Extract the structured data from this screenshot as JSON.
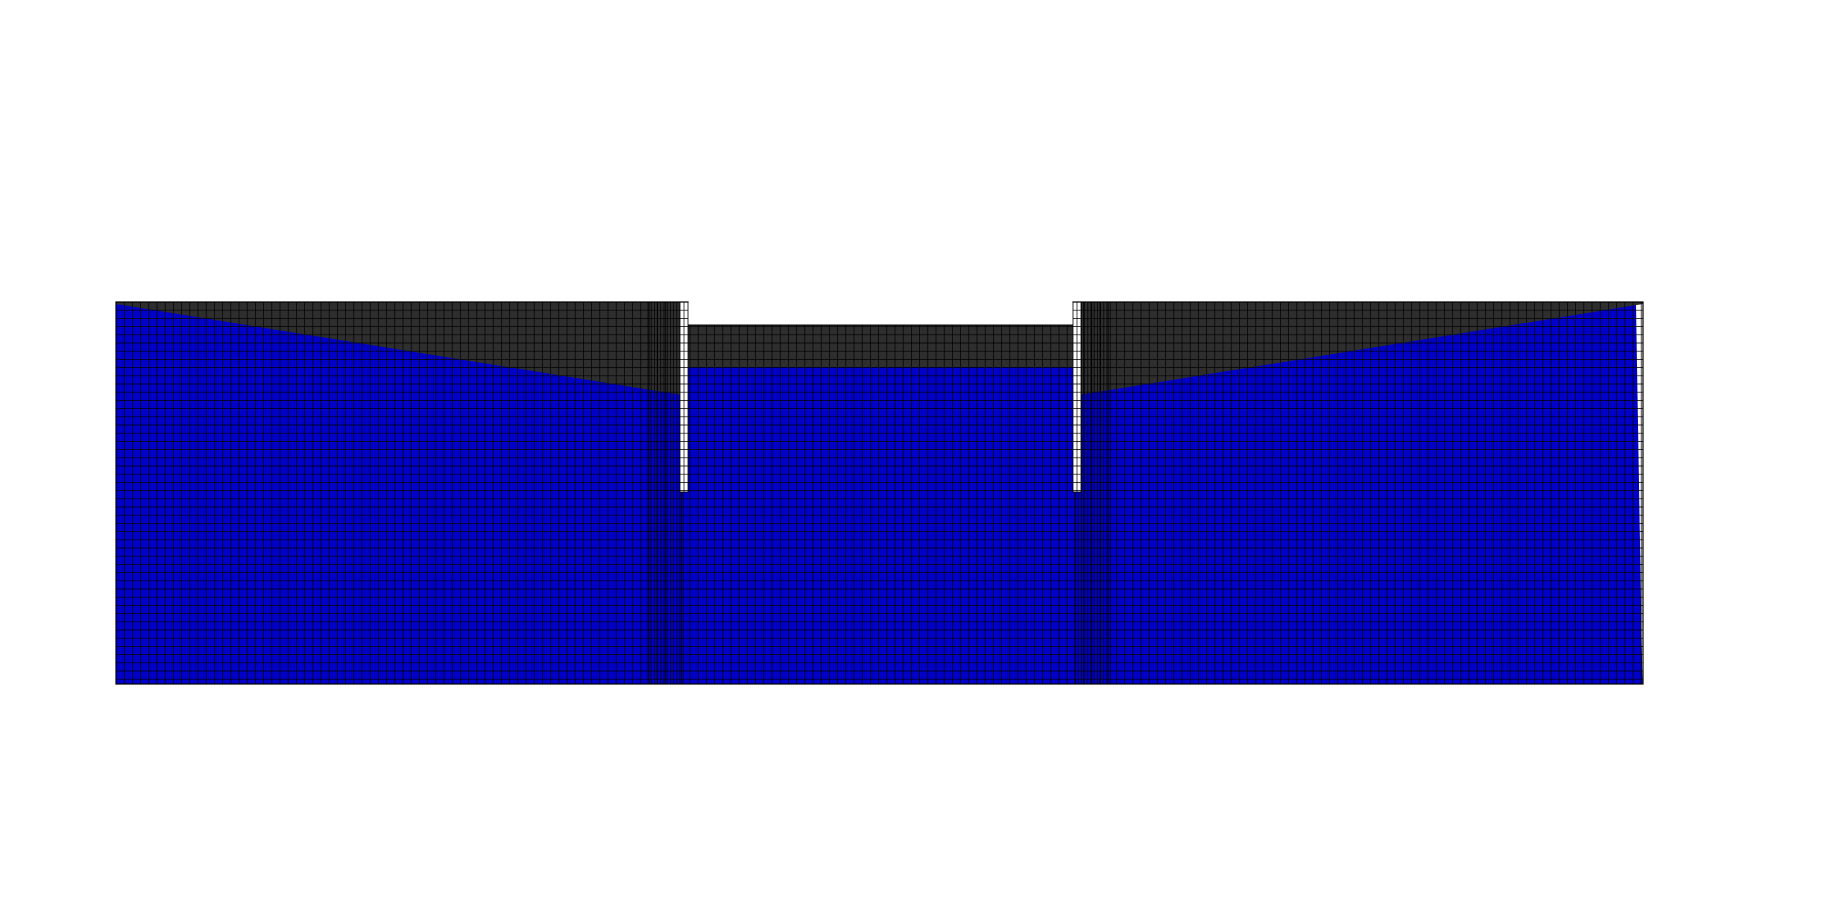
{
  "figure": {
    "type": "finite-element mesh contour plot",
    "description_visible_text": "",
    "palette": {
      "inactive_soil": "#2e2e2e",
      "wall": "#ffffff",
      "mesh_line": "#000000",
      "contour_bands": [
        "#0000c8",
        "#0030c0",
        "#0068c8",
        "#0098c8",
        "#00c8c0",
        "#00c890",
        "#00c040",
        "#20c800",
        "#80c800",
        "#c8c800",
        "#d8a000",
        "#d86000",
        "#c80000"
      ]
    },
    "legend_visible": false,
    "axes_visible": false
  }
}
